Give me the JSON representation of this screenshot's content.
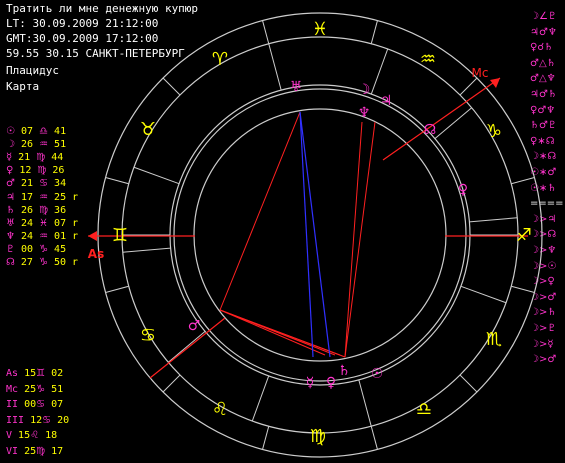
{
  "header": {
    "title": "Тратить ли мне денежную купюр",
    "lt": "LT: 30.09.2009 21:12:00",
    "gmt": "GMT:30.09.2009 17:12:00",
    "location": "59.55 30.15 САНКТ-ПЕТЕРБУРГ",
    "house_system": "Плацидус",
    "chart_label": "Карта"
  },
  "planets": [
    {
      "glyph": "☉",
      "deg": "07",
      "sign": "♎",
      "min": "41",
      "retro": ""
    },
    {
      "glyph": "☽",
      "deg": "26",
      "sign": "♒",
      "min": "51",
      "retro": ""
    },
    {
      "glyph": "☿",
      "deg": "21",
      "sign": "♍",
      "min": "44",
      "retro": ""
    },
    {
      "glyph": "♀",
      "deg": "12",
      "sign": "♍",
      "min": "26",
      "retro": ""
    },
    {
      "glyph": "♂",
      "deg": "21",
      "sign": "♋",
      "min": "34",
      "retro": ""
    },
    {
      "glyph": "♃",
      "deg": "17",
      "sign": "♒",
      "min": "25",
      "retro": "r"
    },
    {
      "glyph": "♄",
      "deg": "26",
      "sign": "♍",
      "min": "36",
      "retro": ""
    },
    {
      "glyph": "♅",
      "deg": "24",
      "sign": "♓",
      "min": "07",
      "retro": "r"
    },
    {
      "glyph": "♆",
      "deg": "24",
      "sign": "♒",
      "min": "01",
      "retro": "r"
    },
    {
      "glyph": "♇",
      "deg": "00",
      "sign": "♑",
      "min": "45",
      "retro": ""
    },
    {
      "glyph": "☊",
      "deg": "27",
      "sign": "♑",
      "min": "50",
      "retro": "r"
    }
  ],
  "houses": [
    {
      "label": "As",
      "deg": "15",
      "sign": "♊",
      "min": "02"
    },
    {
      "label": "Mc",
      "deg": "25",
      "sign": "♑",
      "min": "51"
    },
    {
      "label": "II",
      "deg": "00",
      "sign": "♋",
      "min": "07"
    },
    {
      "label": "III",
      "deg": "12",
      "sign": "♋",
      "min": "20"
    },
    {
      "label": "V",
      "deg": "15",
      "sign": "♌",
      "min": "18"
    },
    {
      "label": "VI",
      "deg": "25",
      "sign": "♍",
      "min": "17"
    }
  ],
  "aspects_right": [
    "☽∠♇",
    "♃♂♆",
    "♀☌♄",
    "♂△♄",
    "♂△♆",
    "♃♂♄",
    "♀♂♆",
    "♄♂♇",
    "♀∗☊",
    "☽∗☊",
    "☉∗♂",
    "☉∗♄",
    "====",
    "☽>♃",
    "☽>☊",
    "☽>♆",
    "☽>☉",
    "☽>♀",
    "☽>♂",
    "☽>♄",
    "☽>♇",
    "☽>☿",
    "☽>♂"
  ],
  "wheel": {
    "signs_ring": [
      "♓",
      "♒",
      "♑",
      "♐",
      "♏",
      "♎",
      "♍",
      "♌",
      "♋",
      "♊",
      "♉",
      "♈"
    ],
    "asc_label": "As",
    "mc_label": "Mc",
    "planet_glyphs": [
      "♅",
      "☽",
      "♆",
      "♃",
      "☊",
      "♀",
      "♂",
      "☿",
      "♀",
      "♄",
      "☉"
    ]
  },
  "colors": {
    "text": "#ffffff",
    "accent_yellow": "#ffff00",
    "accent_magenta": "#ff33cc",
    "red_line": "#ff2020",
    "blue_line": "#3030ff",
    "ring": "#cccccc"
  }
}
